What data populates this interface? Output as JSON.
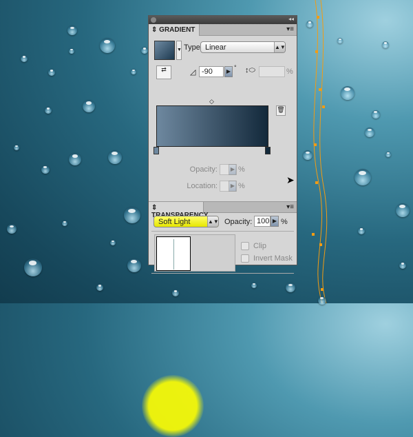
{
  "gradient_panel": {
    "tab": "GRADIENT",
    "type_label": "Type:",
    "type_value": "Linear",
    "angle_value": "-90",
    "degree": "°",
    "aspect_value": "",
    "percent": "%",
    "opacity_label": "Opacity:",
    "opacity_value": "",
    "location_label": "Location:",
    "location_value": ""
  },
  "transparency_panel": {
    "tab": "TRANSPARENCY",
    "blend_mode": "Soft Light",
    "opacity_label": "Opacity:",
    "opacity_value": "100",
    "percent": "%",
    "clip_label": "Clip",
    "invert_mask_label": "Invert Mask"
  },
  "colors": {
    "accent_path": "#f39c12",
    "highlight": "#ffff00"
  }
}
